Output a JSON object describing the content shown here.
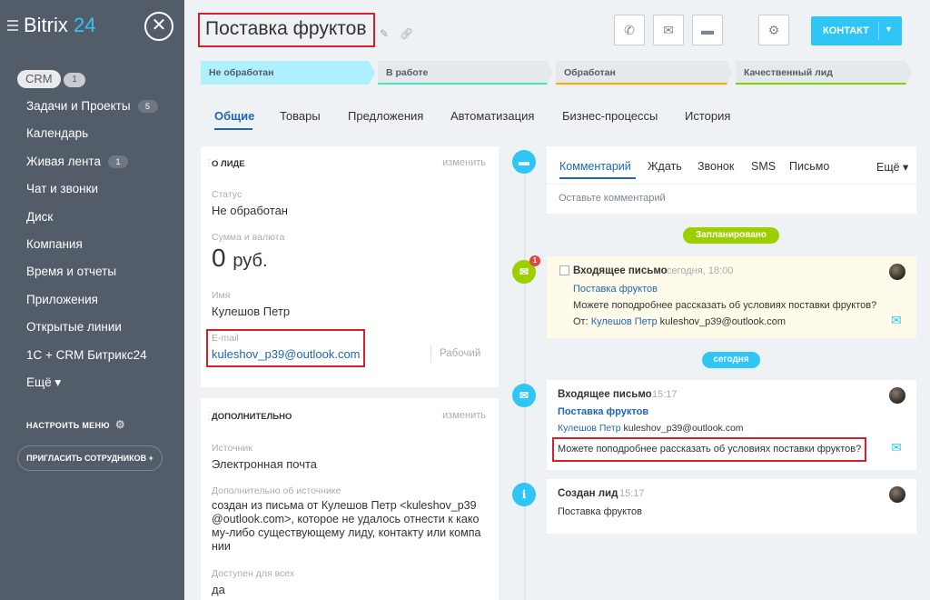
{
  "sidebar": {
    "logo_main": "Bitrix",
    "logo_num": "24",
    "crm_label": "CRM",
    "crm_count": "1",
    "items": [
      {
        "label": "Задачи и Проекты",
        "badge": "5"
      },
      {
        "label": "Календарь",
        "badge": ""
      },
      {
        "label": "Живая лента",
        "badge": "1"
      },
      {
        "label": "Чат и звонки",
        "badge": ""
      },
      {
        "label": "Диск",
        "badge": ""
      },
      {
        "label": "Компания",
        "badge": ""
      },
      {
        "label": "Время и отчеты",
        "badge": ""
      },
      {
        "label": "Приложения",
        "badge": ""
      },
      {
        "label": "Открытые линии",
        "badge": ""
      },
      {
        "label": "1С + CRM Битрикс24",
        "badge": ""
      },
      {
        "label": "Ещё ▾",
        "badge": ""
      }
    ],
    "settings_label": "НАСТРОИТЬ МЕНЮ",
    "invite_label": "ПРИГЛАСИТЬ СОТРУДНИКОВ +"
  },
  "header": {
    "title": "Поставка фруктов",
    "contact_label": "КОНТАКТ"
  },
  "stages": [
    "Не обработан",
    "В работе",
    "Обработан",
    "Качественный лид"
  ],
  "tabs": [
    "Общие",
    "Товары",
    "Предложения",
    "Автоматизация",
    "Бизнес-процессы",
    "История"
  ],
  "about": {
    "title": "О ЛИДЕ",
    "edit": "изменить",
    "status_label": "Статус",
    "status_value": "Не обработан",
    "sum_label": "Сумма и валюта",
    "sum_value": "0",
    "sum_currency": "руб.",
    "name_label": "Имя",
    "name_value": "Кулешов Петр",
    "email_label": "E-mail",
    "email_value": "kuleshov_p39@outlook.com",
    "email_type": "Рабочий"
  },
  "extra": {
    "title": "ДОПОЛНИТЕЛЬНО",
    "edit": "изменить",
    "source_label": "Источник",
    "source_value": "Электронная почта",
    "source_info_label": "Дополнительно об источнике",
    "source_info_lines": [
      "создан из письма от Кулешов Петр <kuleshov_p39",
      "@outlook.com>, которое не удалось отнести к како",
      "му-либо существующему лиду, контакту или компа",
      "нии"
    ],
    "access_label": "Доступен для всех",
    "access_value": "да"
  },
  "editor": {
    "tabs": [
      "Комментарий",
      "Ждать",
      "Звонок",
      "SMS",
      "Письмо"
    ],
    "more": "Ещё ▾",
    "placeholder": "Оставьте комментарий"
  },
  "timeline": {
    "planned_label": "Запланировано",
    "today_label": "сегодня",
    "planned": {
      "badge": "1",
      "title": "Входящее письмо",
      "time": "сегодня, 18:00",
      "subject": "Поставка фруктов",
      "text": "Можете поподробнее рассказать об условиях поставки фруктов?",
      "from_label": "От:",
      "from_name": "Кулешов Петр",
      "from_email": "kuleshov_p39@outlook.com"
    },
    "mail": {
      "title": "Входящее письмо",
      "time": "15:17",
      "subject": "Поставка фруктов",
      "from_name": "Кулешов Петр",
      "from_email": "kuleshov_p39@outlook.com",
      "text": "Можете поподробнее рассказать об условиях поставки фруктов?"
    },
    "created": {
      "title": "Создан лид",
      "time": "15:17",
      "text": "Поставка фруктов"
    }
  },
  "colors": {
    "sidebar": "#535c69",
    "accent": "#2fc6f6",
    "link": "#2067b0",
    "highlight": "#d8202c",
    "planned_green": "#9dcf00"
  }
}
